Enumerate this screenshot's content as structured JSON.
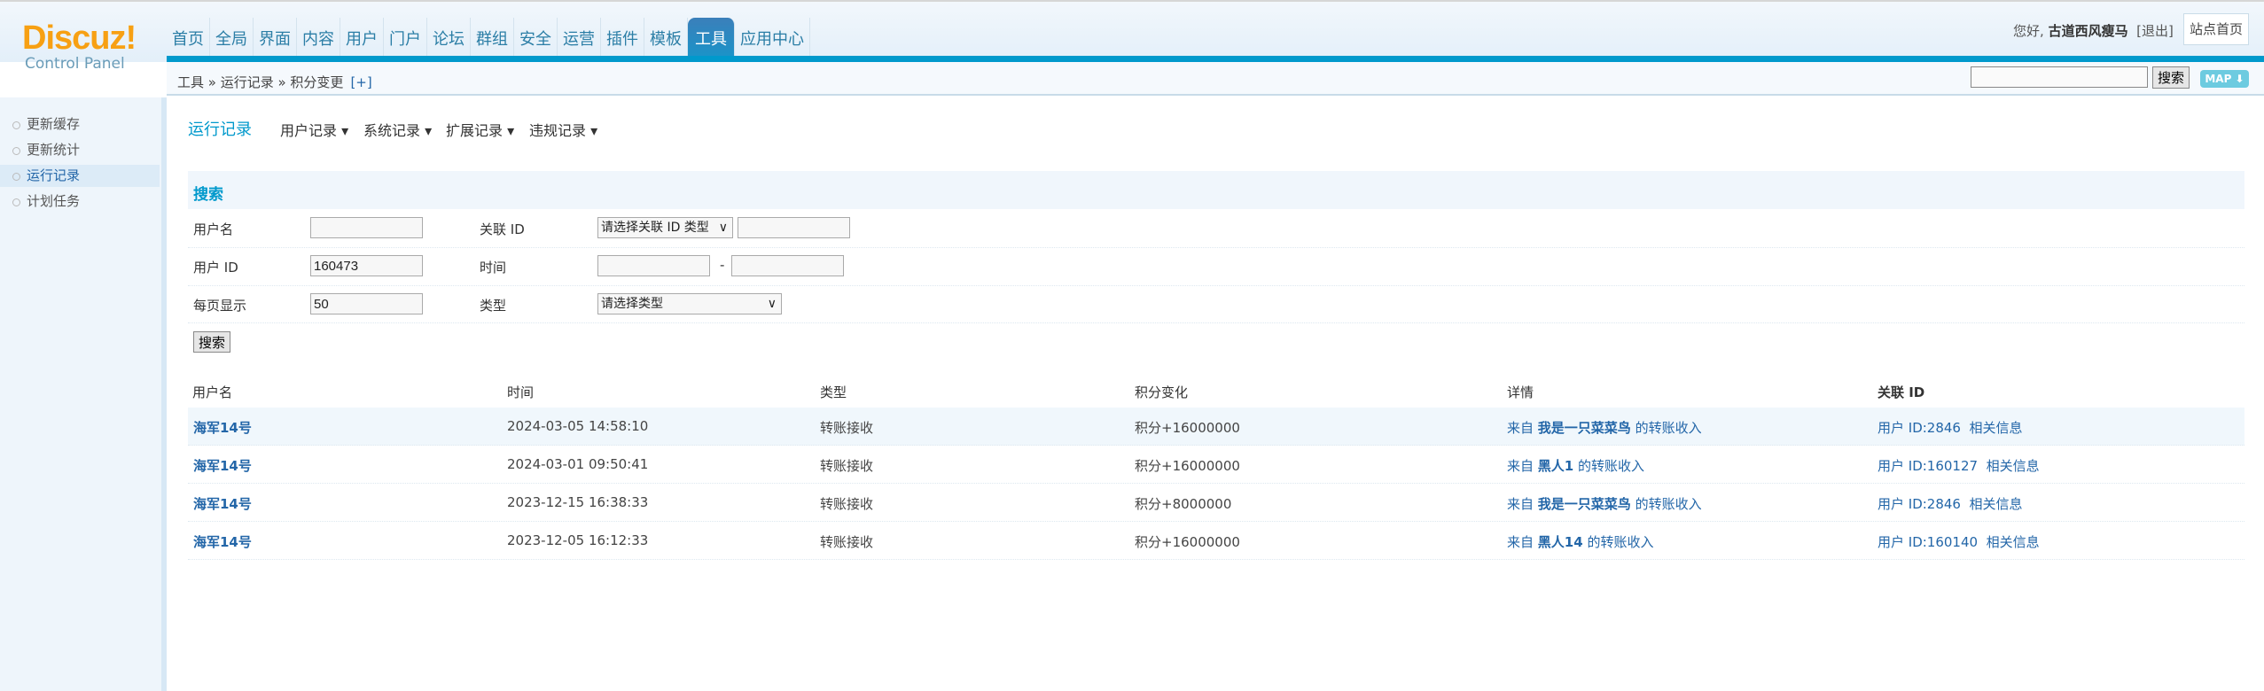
{
  "logo": {
    "text": "Discuz!",
    "sub": "Control Panel"
  },
  "nav": [
    "首页",
    "全局",
    "界面",
    "内容",
    "用户",
    "门户",
    "论坛",
    "群组",
    "安全",
    "运营",
    "插件",
    "模板",
    "工具",
    "应用中心"
  ],
  "nav_active": "工具",
  "user": {
    "greeting": "您好,",
    "name": "古道西风瘦马",
    "logout": "[退出]",
    "site_home": "站点首页"
  },
  "breadcrumb": {
    "text": "工具 » 运行记录 » 积分变更",
    "plus": "[+]"
  },
  "top_search": {
    "value": "",
    "button": "搜索",
    "map": "MAP ⬇"
  },
  "sidebar": [
    {
      "label": "更新缓存"
    },
    {
      "label": "更新统计"
    },
    {
      "label": "运行记录",
      "active": true
    },
    {
      "label": "计划任务"
    }
  ],
  "page": {
    "title": "运行记录",
    "submenus": [
      "用户记录 ▾",
      "系统记录 ▾",
      "扩展记录 ▾",
      "违规记录 ▾"
    ]
  },
  "search": {
    "title": "搜索",
    "username_label": "用户名",
    "username": "",
    "relid_label": "关联 ID",
    "relid_type": "请选择关联 ID 类型",
    "relid": "",
    "uid_label": "用户 ID",
    "uid": "160473",
    "time_label": "时间",
    "time_from": "",
    "time_dash": "-",
    "time_to": "",
    "perpage_label": "每页显示",
    "perpage": "50",
    "type_label": "类型",
    "type": "请选择类型",
    "submit": "搜索"
  },
  "table": {
    "headers": [
      "用户名",
      "时间",
      "类型",
      "积分变化",
      "详情",
      "关联 ID"
    ],
    "rows": [
      {
        "user": "海军14号",
        "time": "2024-03-05 14:58:10",
        "type": "转账接收",
        "change": "积分+16000000",
        "from": "来自",
        "from_user": "我是一只菜菜鸟",
        "detail": "的转账收入",
        "relid": "用户 ID:2846",
        "related": "相关信息"
      },
      {
        "user": "海军14号",
        "time": "2024-03-01 09:50:41",
        "type": "转账接收",
        "change": "积分+16000000",
        "from": "来自",
        "from_user": "黑人1",
        "detail": "的转账收入",
        "relid": "用户 ID:160127",
        "related": "相关信息"
      },
      {
        "user": "海军14号",
        "time": "2023-12-15 16:38:33",
        "type": "转账接收",
        "change": "积分+8000000",
        "from": "来自",
        "from_user": "我是一只菜菜鸟",
        "detail": "的转账收入",
        "relid": "用户 ID:2846",
        "related": "相关信息"
      },
      {
        "user": "海军14号",
        "time": "2023-12-05 16:12:33",
        "type": "转账接收",
        "change": "积分+16000000",
        "from": "来自",
        "from_user": "黑人14",
        "detail": "的转账收入",
        "relid": "用户 ID:160140",
        "related": "相关信息"
      }
    ]
  },
  "colors": {
    "accent": "#0099cc",
    "link": "#2366a8",
    "logo": "#f7a013"
  }
}
